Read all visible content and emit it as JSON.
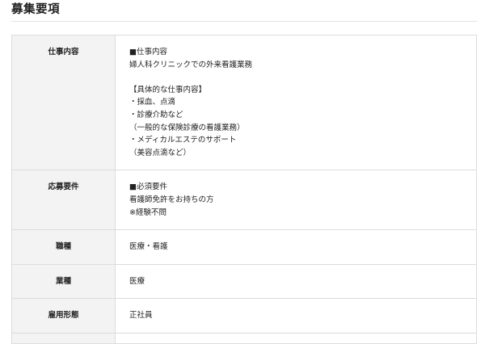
{
  "section": {
    "title": "募集要項"
  },
  "rows": [
    {
      "label": "仕事内容",
      "lines": [
        "■仕事内容",
        "婦人科クリニックでの外来看護業務",
        "",
        "【具体的な仕事内容】",
        "・採血、点滴",
        "・診療介助など",
        "（一般的な保険診療の看護業務）",
        "・メディカルエステのサポート",
        "（美容点滴など）"
      ]
    },
    {
      "label": "応募要件",
      "lines": [
        "■必須要件",
        "看護師免許をお持ちの方",
        "※経験不問"
      ]
    },
    {
      "label": "職種",
      "value": "医療・看護"
    },
    {
      "label": "業種",
      "value": "医療"
    },
    {
      "label": "雇用形態",
      "value": "正社員"
    }
  ]
}
